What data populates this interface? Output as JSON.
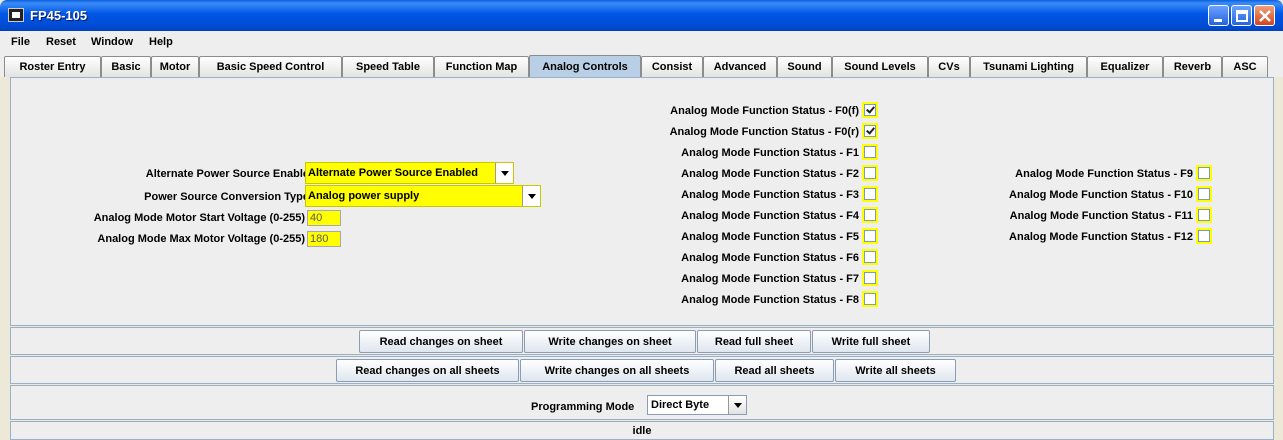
{
  "window": {
    "title": "FP45-105"
  },
  "menu": [
    "File",
    "Reset",
    "Window",
    "Help"
  ],
  "tabs": [
    "Roster Entry",
    "Basic",
    "Motor",
    "Basic Speed Control",
    "Speed Table",
    "Function Map",
    "Analog Controls",
    "Consist",
    "Advanced",
    "Sound",
    "Sound Levels",
    "CVs",
    "Tsunami Lighting",
    "Equalizer",
    "Reverb",
    "ASC"
  ],
  "active_tab": "Analog Controls",
  "left_fields": {
    "alt_power_label": "Alternate Power Source Enable",
    "alt_power_value": "Alternate Power Source Enabled",
    "conversion_label": "Power Source Conversion Type",
    "conversion_value": "Analog power supply",
    "start_voltage_label": "Analog Mode Motor Start Voltage (0-255)",
    "start_voltage_value": "40",
    "max_voltage_label": "Analog Mode Max Motor Voltage (0-255)",
    "max_voltage_value": "180"
  },
  "function_status": {
    "col1": [
      {
        "label": "Analog Mode Function Status - F0(f)",
        "checked": true
      },
      {
        "label": "Analog Mode Function Status - F0(r)",
        "checked": true
      },
      {
        "label": "Analog Mode Function Status - F1",
        "checked": false
      },
      {
        "label": "Analog Mode Function Status - F2",
        "checked": false
      },
      {
        "label": "Analog Mode Function Status - F3",
        "checked": false
      },
      {
        "label": "Analog Mode Function Status - F4",
        "checked": false
      },
      {
        "label": "Analog Mode Function Status - F5",
        "checked": false
      },
      {
        "label": "Analog Mode Function Status - F6",
        "checked": false
      },
      {
        "label": "Analog Mode Function Status - F7",
        "checked": false
      },
      {
        "label": "Analog Mode Function Status - F8",
        "checked": false
      }
    ],
    "col2": [
      {
        "label": "Analog Mode Function Status - F9",
        "checked": false
      },
      {
        "label": "Analog Mode Function Status - F10",
        "checked": false
      },
      {
        "label": "Analog Mode Function Status - F11",
        "checked": false
      },
      {
        "label": "Analog Mode Function Status - F12",
        "checked": false
      }
    ]
  },
  "sheet_buttons": [
    "Read changes on sheet",
    "Write changes on sheet",
    "Read full sheet",
    "Write full sheet"
  ],
  "all_buttons": [
    "Read changes on all sheets",
    "Write changes on all sheets",
    "Read all sheets",
    "Write all sheets"
  ],
  "programming": {
    "label": "Programming Mode",
    "value": "Direct Byte"
  },
  "status": "idle",
  "colors": {
    "highlight": "#ffff00",
    "titlebar": "#0056e5",
    "active_tab": "#b8cfe5"
  }
}
